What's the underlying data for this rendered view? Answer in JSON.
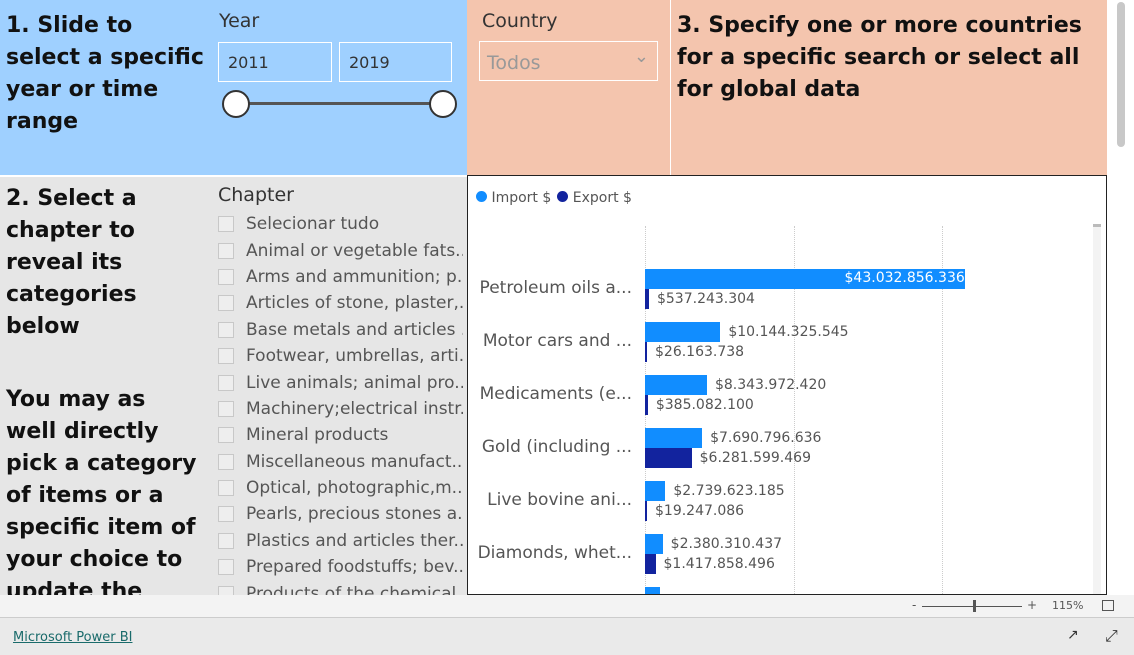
{
  "panel1": {
    "text": "1. Slide to select a specific year or time range",
    "year_label": "Year",
    "year_from": "2011",
    "year_to": "2019",
    "slider_range": [
      2011,
      2019
    ]
  },
  "panel_country": {
    "label": "Country",
    "value": "Todos"
  },
  "panel3": {
    "text": "3. Specify one or more countries for a specific search or select all for global data"
  },
  "panel2": {
    "text": "2. Select a chapter to reveal its categories below",
    "text2": "You may as well directly pick a category of items or a specific item of your choice to update the"
  },
  "chapter": {
    "label": "Chapter",
    "items": [
      "Selecionar tudo",
      "Animal or vegetable fats...",
      "Arms and ammunition; p...",
      "Articles of stone, plaster,...",
      "Base metals and articles ...",
      "Footwear, umbrellas, arti...",
      "Live animals; animal pro...",
      "Machinery;electrical instr...",
      "Mineral products",
      "Miscellaneous manufact...",
      "Optical, photographic,m...",
      "Pearls, precious stones a...",
      "Plastics and articles ther...",
      "Prepared foodstuffs; bev...",
      "Products of the chemical..."
    ]
  },
  "chart_data": {
    "type": "bar",
    "orientation": "horizontal",
    "legend_position": "top-left",
    "grid": true,
    "categories": [
      "Petroleum oils a...",
      "Motor cars and ...",
      "Medicaments (e...",
      "Gold (including ...",
      "Live bovine ani...",
      "Diamonds, whet..."
    ],
    "series": [
      {
        "name": "Import $",
        "color": "#118dff",
        "values": [
          43032856336,
          10144325545,
          8343972420,
          7690796636,
          2739623185,
          2380310437
        ],
        "labels": [
          "$43.032.856.336",
          "$10.144.325.545",
          "$8.343.972.420",
          "$7.690.796.636",
          "$2.739.623.185",
          "$2.380.310.437"
        ]
      },
      {
        "name": "Export $",
        "color": "#12239e",
        "values": [
          537243304,
          26163738,
          385082100,
          6281599469,
          19247086,
          1417858496
        ],
        "labels": [
          "$537.243.304",
          "$26.163.738",
          "$385.082.100",
          "$6.281.599.469",
          "$19.247.086",
          "$1.417.858.496"
        ]
      }
    ],
    "xlim": [
      0,
      60000000000
    ]
  },
  "footer": {
    "zoom": "115%",
    "zoom_minus": "-",
    "zoom_plus": "+",
    "brand": "Microsoft Power BI"
  }
}
